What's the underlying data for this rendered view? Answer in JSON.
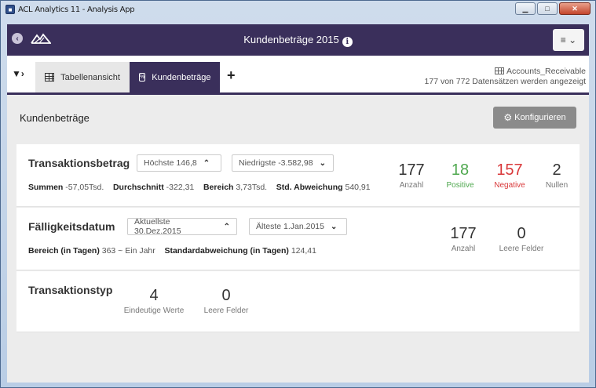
{
  "window": {
    "title": "ACL Analytics 11 - Analysis App"
  },
  "app": {
    "title": "Kundenbeträge 2015",
    "menu_label": "≡ ⌄"
  },
  "tabs": {
    "table_tab": "Tabellenansicht",
    "active_tab": "Kundenbeträge",
    "add": "+"
  },
  "table_info": {
    "name": "Accounts_Receivable",
    "record_count": "177 von 772 Datensätzen werden angezeigt"
  },
  "page": {
    "title": "Kundenbeträge",
    "configure_label": "Konfigurieren"
  },
  "fields": {
    "amount": {
      "name": "Transaktionsbetrag",
      "highest": "Höchste 146,8",
      "lowest": "Niedrigste -3.582,98",
      "sum_label": "Summen",
      "sum_value": "-57,05Tsd.",
      "avg_label": "Durchschnitt",
      "avg_value": "-322,31",
      "range_label": "Bereich",
      "range_value": "3,73Tsd.",
      "std_label": "Std. Abweichung",
      "std_value": "540,91",
      "count": "177",
      "count_label": "Anzahl",
      "positive": "18",
      "positive_label": "Positive",
      "negative": "157",
      "negative_label": "Negative",
      "zeros": "2",
      "zeros_label": "Nullen"
    },
    "due_date": {
      "name": "Fälligkeitsdatum",
      "latest": "Aktuellste 30.Dez.2015",
      "oldest": "Älteste 1.Jan.2015",
      "range_label": "Bereich (in Tagen)",
      "range_value": "363 ~ Ein Jahr",
      "std_label": "Standardabweichung (in Tagen)",
      "std_value": "124,41",
      "count": "177",
      "count_label": "Anzahl",
      "empty": "0",
      "empty_label": "Leere Felder"
    },
    "type": {
      "name": "Transaktionstyp",
      "unique": "4",
      "unique_label": "Eindeutige Werte",
      "empty": "0",
      "empty_label": "Leere Felder"
    }
  },
  "colors": {
    "header": "#3a2f5b",
    "positive": "#4fa84f",
    "negative": "#d9383a"
  },
  "icons": [
    "back-icon",
    "mountain-logo-icon",
    "info-icon",
    "hamburger-menu-icon",
    "filter-icon",
    "table-grid-icon",
    "chart-icon",
    "add-icon",
    "gear-icon",
    "chevron-up-icon",
    "chevron-down-icon"
  ]
}
